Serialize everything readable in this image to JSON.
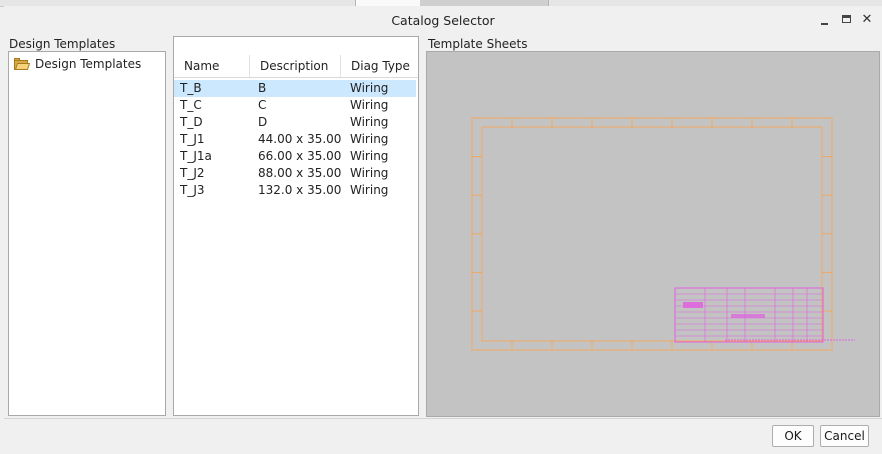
{
  "window": {
    "title": "Catalog Selector"
  },
  "left_panel": {
    "label": "Design Templates",
    "tree": [
      {
        "label": "Design Templates",
        "icon": "folder-open-icon"
      }
    ]
  },
  "list_panel": {
    "columns": {
      "name": "Name",
      "description": "Description",
      "diag_type": "Diag Type"
    },
    "rows": [
      {
        "name": "T_B",
        "description": "B",
        "diag_type": "Wiring",
        "selected": true
      },
      {
        "name": "T_C",
        "description": "C",
        "diag_type": "Wiring",
        "selected": false
      },
      {
        "name": "T_D",
        "description": "D",
        "diag_type": "Wiring",
        "selected": false
      },
      {
        "name": "T_J1",
        "description": "44.00 x 35.00",
        "diag_type": "Wiring",
        "selected": false
      },
      {
        "name": "T_J1a",
        "description": "66.00 x 35.00",
        "diag_type": "Wiring",
        "selected": false
      },
      {
        "name": "T_J2",
        "description": "88.00 x 35.00",
        "diag_type": "Wiring",
        "selected": false
      },
      {
        "name": "T_J3",
        "description": "132.0 x 35.00",
        "diag_type": "Wiring",
        "selected": false
      }
    ]
  },
  "sheets_panel": {
    "label": "Template Sheets",
    "background_color": "#c3c3c3",
    "border_color": "#f0a860",
    "title_block_color": "#e060e0"
  },
  "buttons": {
    "ok": "OK",
    "cancel": "Cancel"
  },
  "colors": {
    "selection": "#cce8ff",
    "dialog_bg": "#f0f0f0"
  }
}
